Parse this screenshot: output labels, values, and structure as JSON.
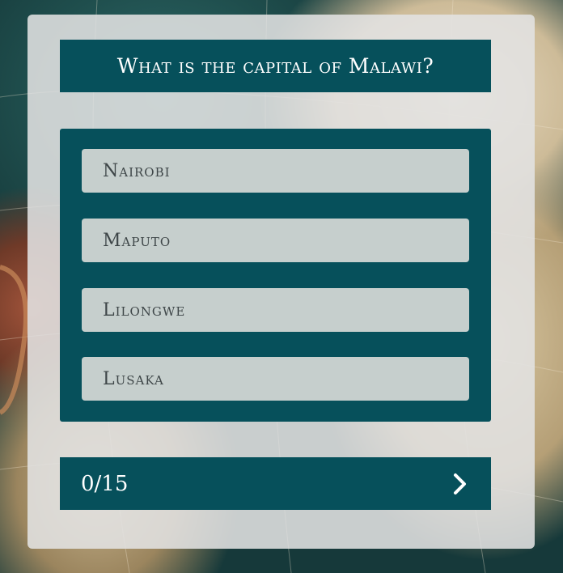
{
  "question": {
    "text": "What is the capital of Malawi?"
  },
  "answers": [
    {
      "label": "Nairobi"
    },
    {
      "label": "Maputo"
    },
    {
      "label": "Lilongwe"
    },
    {
      "label": "Lusaka"
    }
  ],
  "footer": {
    "progress": "0/15",
    "next_icon": "chevron-right-icon"
  },
  "colors": {
    "primary": "#06505b",
    "answer_bg": "#c6cfcd",
    "panel_bg": "#e2e2e2"
  }
}
